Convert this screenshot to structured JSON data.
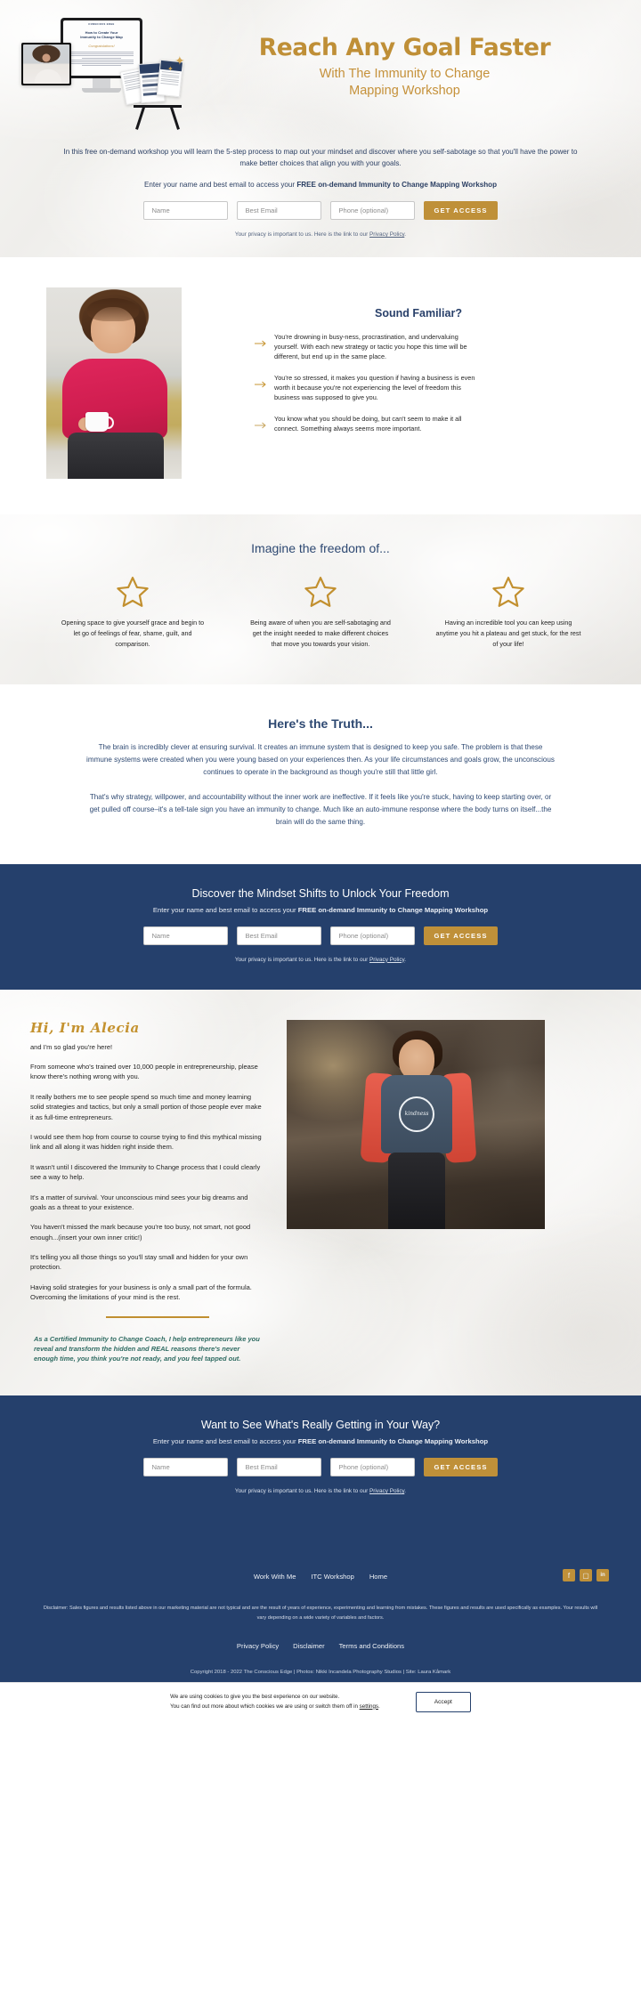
{
  "colors": {
    "gold": "#bf9039",
    "navy": "#25406c",
    "heading_blue": "#2e4972",
    "teal": "#2f6b62"
  },
  "hero": {
    "headline": "Reach Any Goal Faster",
    "subheadline_line1": "With The Immunity to Change",
    "subheadline_line2": "Mapping Workshop",
    "intro": "In this free on-demand workshop you will learn the 5-step process to map out your mindset and discover where you self-sabotage so that you'll have the power to make better choices that align you with your goals.",
    "cta_prompt_prefix": "Enter your name and best email to access your ",
    "cta_prompt_bold": "FREE on-demand Immunity to Change Mapping Workshop",
    "device_screen": {
      "logo": "CONSCIOUS EDGE",
      "title_line1": "How to Create Your",
      "title_line2": "Immunity to Change Map",
      "script": "Congratulations!"
    }
  },
  "form": {
    "name_placeholder": "Name",
    "email_placeholder": "Best Email",
    "phone_placeholder": "Phone (optional)",
    "submit_label": "GET ACCESS",
    "privacy_prefix": "Your privacy is important to us. Here is the link to our ",
    "privacy_link": "Privacy Policy",
    "privacy_suffix": "."
  },
  "familiar": {
    "title": "Sound Familiar?",
    "bullets": [
      "You're drowning in busy-ness, procrastination, and undervaluing yourself. With each new strategy or tactic you hope this time will be different, but end up in the same place.",
      "You're so stressed, it makes you question if having a business is even worth it because you're not experiencing the level of freedom this business was supposed to give you.",
      "You know what you should be doing, but can't seem to make it all connect. Something always seems more important."
    ]
  },
  "imagine": {
    "title": "Imagine the freedom of...",
    "cards": [
      {
        "icon": "star-icon",
        "text": "Opening space to give yourself grace and begin to let go of feelings of fear, shame, guilt, and comparison."
      },
      {
        "icon": "star-icon",
        "text": "Being aware of when you are self-sabotaging and get the insight needed to make different choices that move you towards your vision."
      },
      {
        "icon": "star-icon",
        "text": "Having an incredible tool you can keep using anytime you hit a plateau and get stuck, for the rest of your life!"
      }
    ]
  },
  "truth": {
    "title": "Here's the Truth...",
    "paragraph1": "The brain is incredibly clever at ensuring survival. It creates an immune system that is designed to keep you safe. The problem is that these immune systems were created when you were young based on your experiences then. As your life circumstances and goals grow, the unconscious continues to operate in the background as though you're still that little girl.",
    "paragraph2": "That's why strategy, willpower, and accountability without the inner work are ineffective. If it feels like you're stuck, having to keep starting over, or get pulled off course–it's a tell-tale sign you have an immunity to change. Much like an auto-immune response where the body turns on itself...the brain will do the same thing."
  },
  "cta_mid": {
    "title": "Discover the Mindset Shifts to Unlock Your Freedom",
    "subtitle_prefix": "Enter your name and best email to access your ",
    "subtitle_bold": "FREE on-demand Immunity to Change Mapping Workshop"
  },
  "about": {
    "script_name": "Hi, I'm Alecia",
    "paragraphs": [
      "and I'm so glad you're here!",
      "From someone who's trained over 10,000 people in entrepreneurship, please know there's nothing wrong with you.",
      "It really bothers me to see people spend so much time and money learning solid strategies and tactics, but only a small portion of those people ever make it as full-time entrepreneurs.",
      "I would see them hop from course to course trying to find this mythical missing link and all along it was hidden right inside them.",
      "It wasn't until I discovered the Immunity to Change process that I could clearly see a way to help.",
      "It's a matter of survival. Your unconscious mind sees your big dreams and goals as a threat to your existence.",
      "You haven't missed the mark because you're too busy, not smart, not good enough...(insert your own inner critic!)",
      "It's telling you all those things so you'll stay small and hidden for your own protection.",
      "Having solid strategies for your business is only a small part of the formula. Overcoming the limitations of your mind is the rest."
    ],
    "quote": "As a Certified Immunity to Change Coach, I help entrepreneurs like you reveal and transform the hidden and REAL reasons there's never enough time, you think you're not ready, and you feel tapped out.",
    "photo_shirt_text": "kindness"
  },
  "cta_bottom": {
    "title": "Want to See What's Really Getting in Your Way?",
    "subtitle_prefix": "Enter your name and best email to access your ",
    "subtitle_bold": "FREE on-demand Immunity to Change Mapping Workshop"
  },
  "footer": {
    "nav": [
      {
        "label": "Work With Me"
      },
      {
        "label": "ITC Workshop"
      },
      {
        "label": "Home"
      }
    ],
    "social": [
      {
        "icon": "facebook-icon",
        "glyph": "f"
      },
      {
        "icon": "instagram-icon",
        "glyph": "▢"
      },
      {
        "icon": "linkedin-icon",
        "glyph": "in"
      }
    ],
    "disclaimer": "Disclaimer: Sales figures and results listed above in our marketing material are not typical and are the result of years of experience, experimenting and learning from mistakes. These figures and results are used specifically as examples. Your results will vary depending on a wide variety of variables and factors.",
    "legal": [
      {
        "label": "Privacy Policy"
      },
      {
        "label": "Disclaimer"
      },
      {
        "label": "Terms and Conditions"
      }
    ],
    "copyright": "Copyright 2018 - 2022 The Conscious Edge | Photos: Nikki Incandela Photography Studios  | Site: Laura Kåmark"
  },
  "cookie": {
    "line1": "We are using cookies to give you the best experience on our website.",
    "line2_prefix": "You can find out more about which cookies we are using or switch them off in ",
    "line2_link": "settings",
    "line2_suffix": ".",
    "accept_label": "Accept"
  }
}
